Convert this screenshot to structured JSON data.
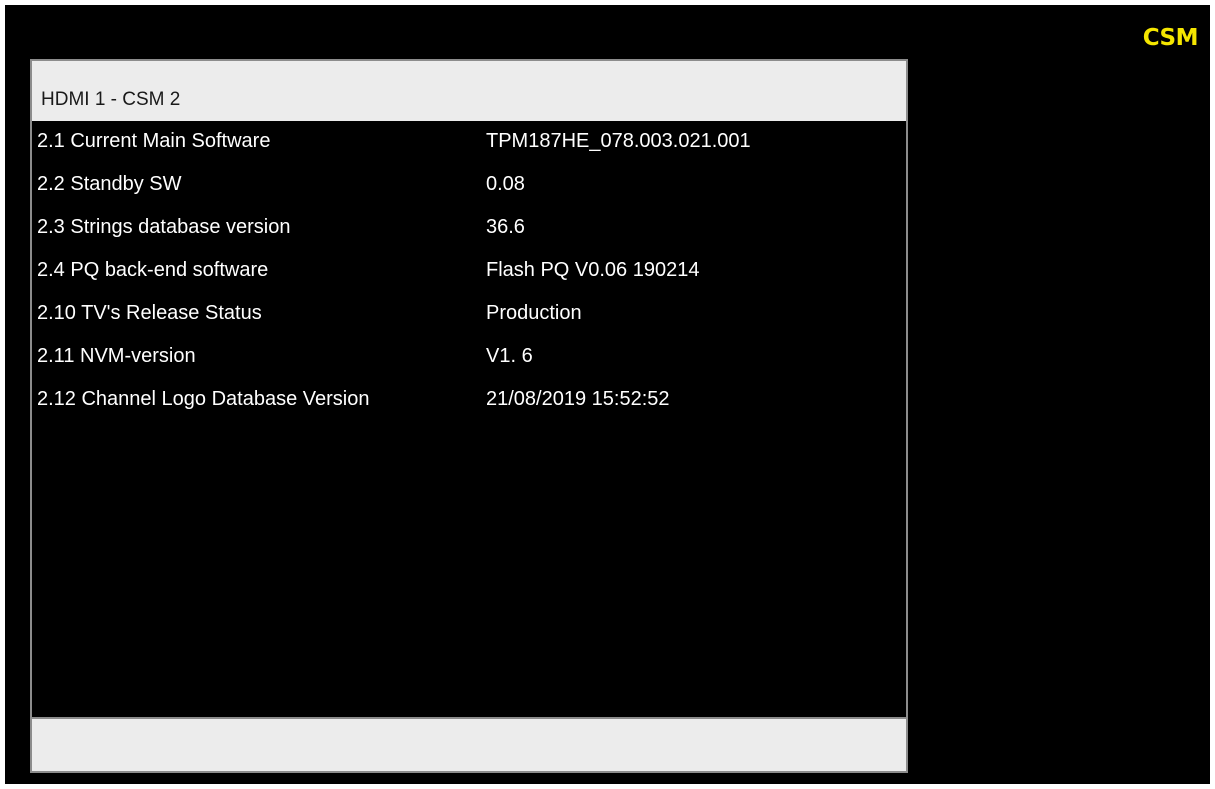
{
  "badge": "CSM",
  "panel": {
    "title": "HDMI 1 - CSM 2",
    "rows": [
      {
        "label": "2.1 Current Main Software",
        "value": "TPM187HE_078.003.021.001"
      },
      {
        "label": "2.2 Standby SW",
        "value": "0.08"
      },
      {
        "label": "2.3 Strings database version",
        "value": "36.6"
      },
      {
        "label": "2.4 PQ back-end software",
        "value": "Flash PQ V0.06 190214"
      },
      {
        "label": "2.10 TV's Release Status",
        "value": "Production"
      },
      {
        "label": "2.11 NVM-version",
        "value": "V1. 6"
      },
      {
        "label": "2.12 Channel Logo Database Version",
        "value": "21/08/2019 15:52:52"
      }
    ],
    "footer": ""
  },
  "colors": {
    "background": "#000000",
    "badge": "#f5e600",
    "header_bar": "#ececec",
    "border": "#8c8c8c",
    "text": "#ffffff"
  }
}
